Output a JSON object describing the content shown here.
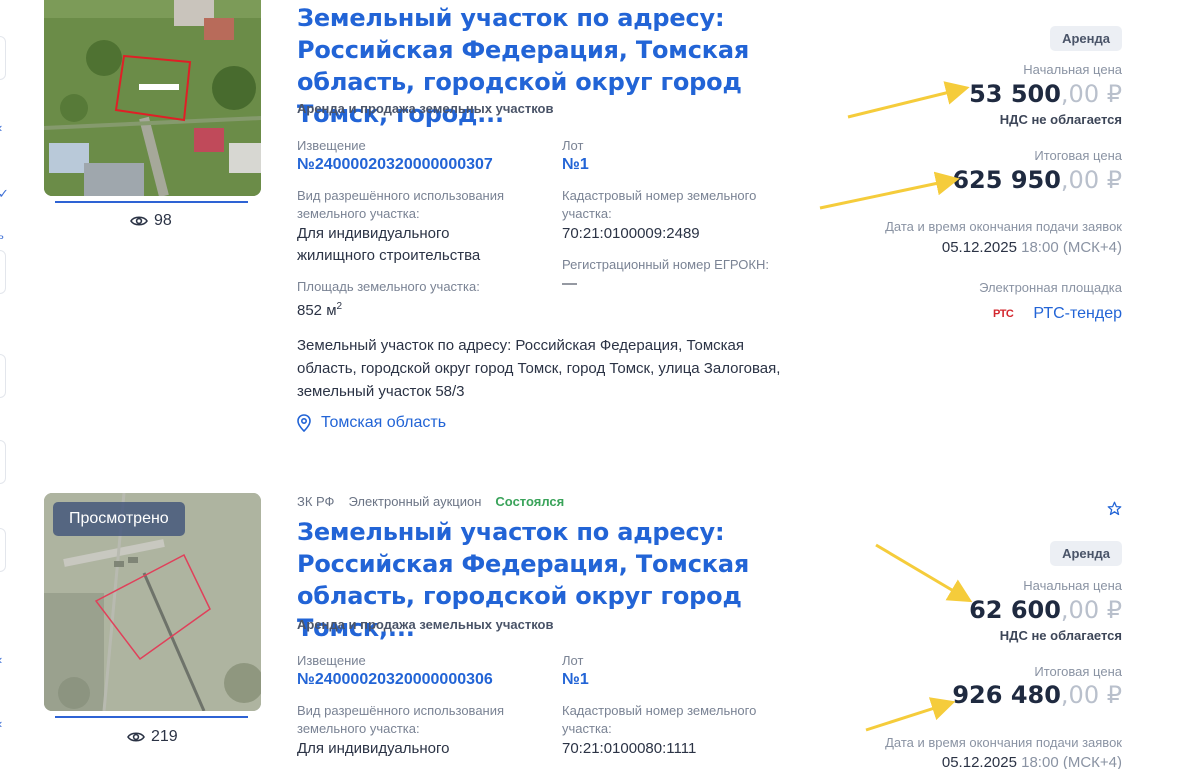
{
  "sidebar": {
    "cut_label": "ь"
  },
  "listings": [
    {
      "title": "Земельный участок по адресу: Российская Федерация, Томская область, городской округ город Томск, город...",
      "category": "Аренда и продажа земельных участков",
      "views": "98",
      "notice_label": "Извещение",
      "notice_number": "№24000020320000000307",
      "lot_label": "Лот",
      "lot_number": "№1",
      "use_label": "Вид разрешённого использования земельного участка:",
      "use_value": "Для индивидуального жилищного строительства",
      "cadastral_label": "Кадастровый номер земельного участка:",
      "cadastral_value": "70:21:0100009:2489",
      "egrokn_label": "Регистрационный номер ЕГРОКН:",
      "egrokn_value": "—",
      "area_label": "Площадь земельного участка:",
      "area_value": "852 м",
      "area_unit_sup": "2",
      "description": "Земельный участок по адресу: Российская Федерация, Томская область, городской округ город Томск, город Томск, улица Залоговая, земельный участок 58/3",
      "region": "Томская область",
      "badge": "Аренда",
      "start_price_label": "Начальная цена",
      "start_price_int": "53 500",
      "start_price_dec": ",00 ₽",
      "vat": "НДС не облагается",
      "final_price_label": "Итоговая цена",
      "final_price_int": "625 950",
      "final_price_dec": ",00 ₽",
      "deadline_label": "Дата и время окончания подачи заявок",
      "deadline_date": "05.12.2025",
      "deadline_time": "18:00 (МСК+4)",
      "platform_label": "Электронная площадка",
      "platform_logo": "РТС",
      "platform_name": "РТС-тендер"
    },
    {
      "tags": [
        "ЗК РФ",
        "Электронный аукцион",
        "Состоялся"
      ],
      "seen_overlay": "Просмотрено",
      "title": "Земельный участок по адресу: Российская Федерация, Томская область, городской округ город Томск,...",
      "category": "Аренда и продажа земельных участков",
      "views": "219",
      "notice_label": "Извещение",
      "notice_number": "№24000020320000000306",
      "lot_label": "Лот",
      "lot_number": "№1",
      "use_label": "Вид разрешённого использования земельного участка:",
      "use_value": "Для индивидуального",
      "cadastral_label": "Кадастровый номер земельного участка:",
      "cadastral_value": "70:21:0100080:1111",
      "badge": "Аренда",
      "start_price_label": "Начальная цена",
      "start_price_int": "62 600",
      "start_price_dec": ",00 ₽",
      "vat": "НДС не облагается",
      "final_price_label": "Итоговая цена",
      "final_price_int": "926 480",
      "final_price_dec": ",00 ₽",
      "deadline_label": "Дата и время окончания подачи заявок",
      "deadline_date": "05.12.2025",
      "deadline_time": "18:00 (МСК+4)"
    }
  ],
  "colors": {
    "accent": "#2264d6",
    "arrow": "#f5cc3b",
    "success": "#3aa35a"
  },
  "icons": [
    "eye-icon",
    "location-pin-icon",
    "star-icon",
    "rts-logo"
  ]
}
